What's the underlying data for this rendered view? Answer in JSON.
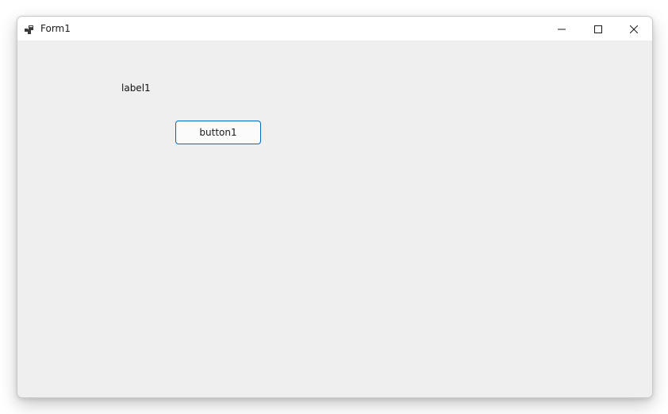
{
  "window": {
    "title": "Form1",
    "app_icon": "form-app-icon",
    "caption_buttons": {
      "minimize_icon": "minimize-icon",
      "maximize_icon": "maximize-icon",
      "close_icon": "close-icon"
    }
  },
  "form": {
    "label1": "label1",
    "button1": "button1"
  },
  "colors": {
    "client_background": "#efefef",
    "titlebar_background": "#ffffff",
    "button_border_accent": "#0067c0"
  }
}
